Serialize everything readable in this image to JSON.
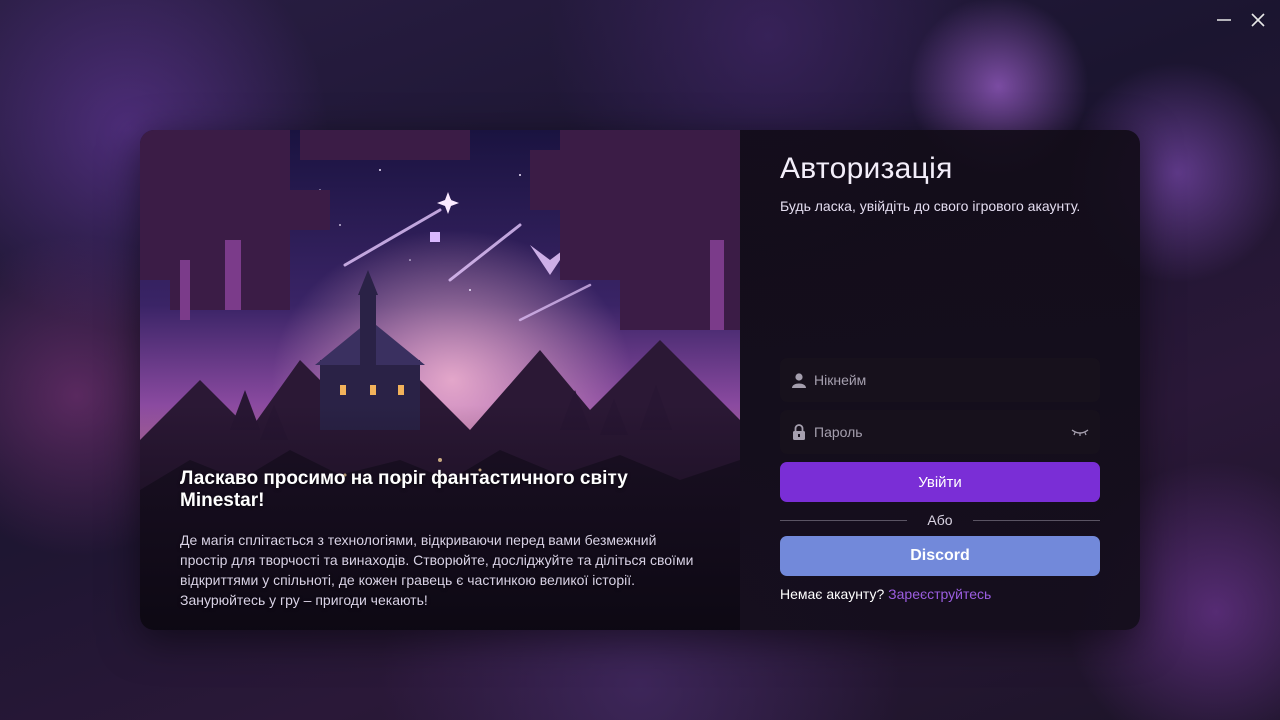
{
  "window": {
    "minimize_icon": "minimize-icon",
    "close_icon": "close-icon"
  },
  "hero": {
    "title": "Ласкаво просимо на поріг фантастичного світу Minestar!",
    "description": "Де магія сплітається з технологіями, відкриваючи перед вами безмежний простір для творчості та винаходів. Створюйте, досліджуйте та діліться своїми відкриттями у спільноті, де кожен гравець є частинкою великої історії. Занурюйтесь у гру – пригоди чекають!"
  },
  "auth": {
    "title": "Авторизація",
    "subtitle": "Будь ласка, увійдіть до свого ігрового акаунту.",
    "nickname_placeholder": "Нікнейм",
    "password_placeholder": "Пароль",
    "login_label": "Увійти",
    "or_label": "Або",
    "discord_label": "Discord",
    "no_account_label": "Немає акаунту?",
    "register_link": "Зареєструйтесь"
  },
  "colors": {
    "accent": "#7a2ed6",
    "discord": "#7289da",
    "link": "#9b5de0"
  }
}
